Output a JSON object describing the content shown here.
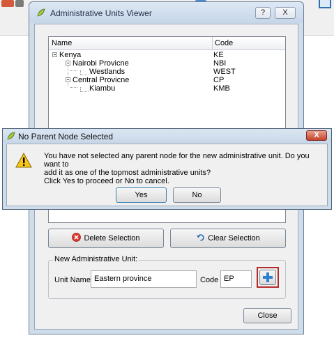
{
  "main_window": {
    "title": "Administrative Units Viewer",
    "help_button": "?",
    "close_button": "X",
    "tree": {
      "columns": [
        "Name",
        "Code"
      ],
      "rows": [
        {
          "name": "Kenya",
          "code": "KE"
        },
        {
          "name": "Nairobi Provicne",
          "code": "NBI"
        },
        {
          "name": "Westlands",
          "code": "WEST"
        },
        {
          "name": "Central Provicne",
          "code": "CP"
        },
        {
          "name": "Kiambu",
          "code": "KMB"
        }
      ]
    },
    "delete_selection_label": "Delete Selection",
    "clear_selection_label": "Clear Selection",
    "new_unit_group": {
      "title": "New Administrative Unit:",
      "unit_name_label": "Unit Name",
      "unit_name_value": "Eastern province",
      "code_label": "Code",
      "code_value": "EP"
    },
    "close_label": "Close"
  },
  "message_box": {
    "title": "No Parent Node Selected",
    "close_button": "X",
    "message_line1": "You have not selected any parent node for the new administrative unit. Do you want to",
    "message_line2": "add it as one of the topmost administrative units?",
    "message_line3": "Click Yes to proceed or No to cancel.",
    "yes_label": "Yes",
    "no_label": "No"
  },
  "icons": {
    "app": "qgis-leaf-icon",
    "warning": "warning-triangle-icon",
    "delete": "delete-red-circle-icon",
    "clear": "undo-arrow-icon",
    "add": "plus-icon"
  },
  "colors": {
    "highlight_border": "#b42b2b",
    "plus_blue": "#2f7fd0",
    "delete_red": "#d93a2f"
  }
}
